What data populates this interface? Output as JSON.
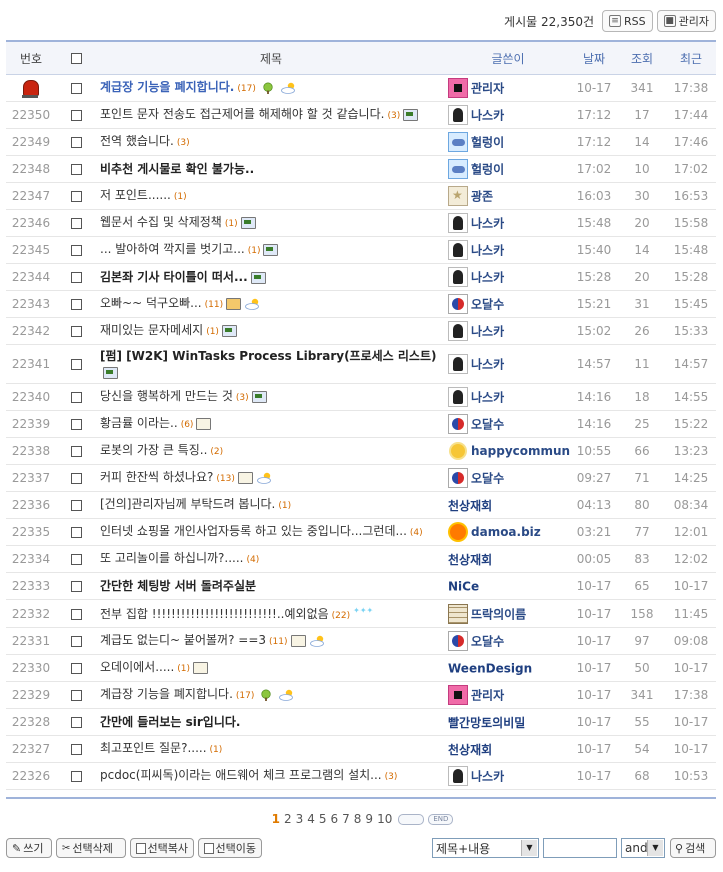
{
  "top": {
    "post_count": "게시물 22,350건",
    "rss_label": "RSS",
    "admin_label": "관리자"
  },
  "table": {
    "headers": {
      "num": "번호",
      "subject": "제목",
      "author": "글쓴이",
      "date": "날짜",
      "hits": "조회",
      "last": "최근"
    },
    "rows": [
      {
        "num": "",
        "notice": true,
        "subject": "계급장 기능을 폐지합니다.",
        "comments": "(17)",
        "icons": [
          "tree-icon",
          "weather-icon"
        ],
        "author": "관리자",
        "avatar": "pink",
        "date": "10-17",
        "hits": "341",
        "last": "17:38"
      },
      {
        "num": "22350",
        "subject": "포인트 문자 전송도 접근제어를 해제해야 할 것 같습니다.",
        "comments": "(3)",
        "icons": [
          "pc-icon"
        ],
        "author": "나스카",
        "avatar": "ghost",
        "date": "17:12",
        "hits": "17",
        "last": "17:44"
      },
      {
        "num": "22349",
        "subject": "전역 했습니다.",
        "comments": "(3)",
        "icons": [],
        "author": "헐렁이",
        "avatar": "sky",
        "date": "17:12",
        "hits": "14",
        "last": "17:46"
      },
      {
        "num": "22348",
        "bold": true,
        "subject": "비추천 게시물로 확인 불가능..",
        "comments": "",
        "icons": [],
        "author": "헐렁이",
        "avatar": "sky",
        "date": "17:02",
        "hits": "10",
        "last": "17:02"
      },
      {
        "num": "22347",
        "subject": "저 포인트......",
        "comments": "(1)",
        "icons": [],
        "author": "광존",
        "avatar": "star",
        "date": "16:03",
        "hits": "30",
        "last": "16:53"
      },
      {
        "num": "22346",
        "subject": "웹문서 수집 및 삭제정책",
        "comments": "(1)",
        "icons": [
          "pc-icon"
        ],
        "author": "나스카",
        "avatar": "ghost",
        "date": "15:48",
        "hits": "20",
        "last": "15:58"
      },
      {
        "num": "22345",
        "subject": "... 발아하여 깍지를 벗기고...",
        "comments": "(1)",
        "icons": [
          "pc-icon"
        ],
        "author": "나스카",
        "avatar": "ghost",
        "date": "15:40",
        "hits": "14",
        "last": "15:48"
      },
      {
        "num": "22344",
        "bold": true,
        "subject": "김본좌 기사 타이틀이 떠서...",
        "comments": "",
        "icons": [
          "pc-icon"
        ],
        "author": "나스카",
        "avatar": "ghost",
        "date": "15:28",
        "hits": "20",
        "last": "15:28"
      },
      {
        "num": "22343",
        "subject": "오빠~~ 덕구오빠...",
        "comments": "(11)",
        "icons": [
          "mail-icon",
          "weather-icon"
        ],
        "author": "오달수",
        "avatar": "yinyang",
        "date": "15:21",
        "hits": "31",
        "last": "15:45"
      },
      {
        "num": "22342",
        "subject": "재미있는 문자메세지",
        "comments": "(1)",
        "icons": [
          "pc-icon"
        ],
        "author": "나스카",
        "avatar": "ghost",
        "date": "15:02",
        "hits": "26",
        "last": "15:33"
      },
      {
        "num": "22341",
        "bold": true,
        "subject": "[펌] [W2K] WinTasks Process Library(프로세스 리스트)",
        "comments": "",
        "icons": [
          "pc-icon"
        ],
        "author": "나스카",
        "avatar": "ghost",
        "date": "14:57",
        "hits": "11",
        "last": "14:57"
      },
      {
        "num": "22340",
        "subject": "당신을 행복하게 만드는 것",
        "comments": "(3)",
        "icons": [
          "pc-icon"
        ],
        "author": "나스카",
        "avatar": "ghost",
        "date": "14:16",
        "hits": "18",
        "last": "14:55"
      },
      {
        "num": "22339",
        "subject": "황금률 이라는..",
        "comments": "(6)",
        "icons": [
          "note-icon"
        ],
        "author": "오달수",
        "avatar": "yinyang",
        "date": "14:16",
        "hits": "25",
        "last": "15:22"
      },
      {
        "num": "22338",
        "subject": "로봇의 가장 큰 특징..",
        "comments": "(2)",
        "icons": [],
        "author": "happycommun",
        "avatar": "sun",
        "date": "10:55",
        "hits": "66",
        "last": "13:23"
      },
      {
        "num": "22337",
        "subject": "커피 한잔씩 하셨나요?",
        "comments": "(13)",
        "icons": [
          "note-icon",
          "weather-icon"
        ],
        "author": "오달수",
        "avatar": "yinyang",
        "date": "09:27",
        "hits": "71",
        "last": "14:25"
      },
      {
        "num": "22336",
        "subject": "[건의]관리자님께 부탁드려 봅니다.",
        "comments": "(1)",
        "icons": [],
        "author": "천상재회",
        "avatar": "",
        "date": "04:13",
        "hits": "80",
        "last": "08:34"
      },
      {
        "num": "22335",
        "subject": "인터넷 쇼핑몰 개인사업자등록 하고 있는 중입니다...그런데...",
        "comments": "(4)",
        "icons": [],
        "author": "damoa.biz",
        "avatar": "sunbig",
        "date": "03:21",
        "hits": "77",
        "last": "12:01"
      },
      {
        "num": "22334",
        "subject": "또 고리놀이를 하십니까?.....",
        "comments": "(4)",
        "icons": [],
        "author": "천상재회",
        "avatar": "",
        "date": "00:05",
        "hits": "83",
        "last": "12:02"
      },
      {
        "num": "22333",
        "bold": true,
        "subject": "간단한 체팅방 서버 돌려주실분",
        "comments": "",
        "icons": [],
        "author": "NiCe",
        "avatar": "",
        "date": "10-17",
        "hits": "65",
        "last": "10-17"
      },
      {
        "num": "22332",
        "subject": "전부 집합 !!!!!!!!!!!!!!!!!!!!!!!!!!..예외없음",
        "comments": "(22)",
        "icons": [
          "sparkle-icon"
        ],
        "author": "뜨락의이름",
        "avatar": "grid",
        "date": "10-17",
        "hits": "158",
        "last": "11:45"
      },
      {
        "num": "22331",
        "subject": "계급도 없는디~ 붙어볼꺼? ==3",
        "comments": "(11)",
        "icons": [
          "note-icon",
          "weather-icon"
        ],
        "author": "오달수",
        "avatar": "yinyang",
        "date": "10-17",
        "hits": "97",
        "last": "09:08"
      },
      {
        "num": "22330",
        "subject": "오데이에서.....",
        "comments": "(1)",
        "icons": [
          "note-icon"
        ],
        "author": "WeenDesign",
        "avatar": "",
        "date": "10-17",
        "hits": "50",
        "last": "10-17"
      },
      {
        "num": "22329",
        "subject": "계급장 기능을 폐지합니다.",
        "comments": "(17)",
        "icons": [
          "tree-icon",
          "weather-icon"
        ],
        "author": "관리자",
        "avatar": "pink",
        "date": "10-17",
        "hits": "341",
        "last": "17:38"
      },
      {
        "num": "22328",
        "bold": true,
        "subject": "간만에 들러보는 sir입니다.",
        "comments": "",
        "icons": [],
        "author": "빨간망토의비밀",
        "avatar": "",
        "date": "10-17",
        "hits": "55",
        "last": "10-17"
      },
      {
        "num": "22327",
        "subject": "최고포인트 질문?.....",
        "comments": "(1)",
        "icons": [],
        "author": "천상재회",
        "avatar": "",
        "date": "10-17",
        "hits": "54",
        "last": "10-17"
      },
      {
        "num": "22326",
        "subject": "pcdoc(피씨독)이라는 애드웨어 체크 프로그램의 설치...",
        "comments": "(3)",
        "icons": [],
        "author": "나스카",
        "avatar": "ghost",
        "date": "10-17",
        "hits": "68",
        "last": "10:53"
      }
    ]
  },
  "pager": {
    "pages": [
      "1",
      "2",
      "3",
      "4",
      "5",
      "6",
      "7",
      "8",
      "9",
      "10"
    ],
    "current": "1",
    "end_label": "END"
  },
  "bottom": {
    "write_label": "쓰기",
    "delete_label": "선택삭제",
    "copy_label": "선택복사",
    "move_label": "선택이동",
    "search_field": "제목+내용",
    "search_value": "",
    "operator": "and",
    "search_label": "검색"
  },
  "colors": {
    "header_border": "#9fb3da",
    "notice_text": "#3b63b8",
    "author_text": "#2a4a86",
    "comment_count": "#d36b00",
    "current_page": "#e07b00"
  }
}
